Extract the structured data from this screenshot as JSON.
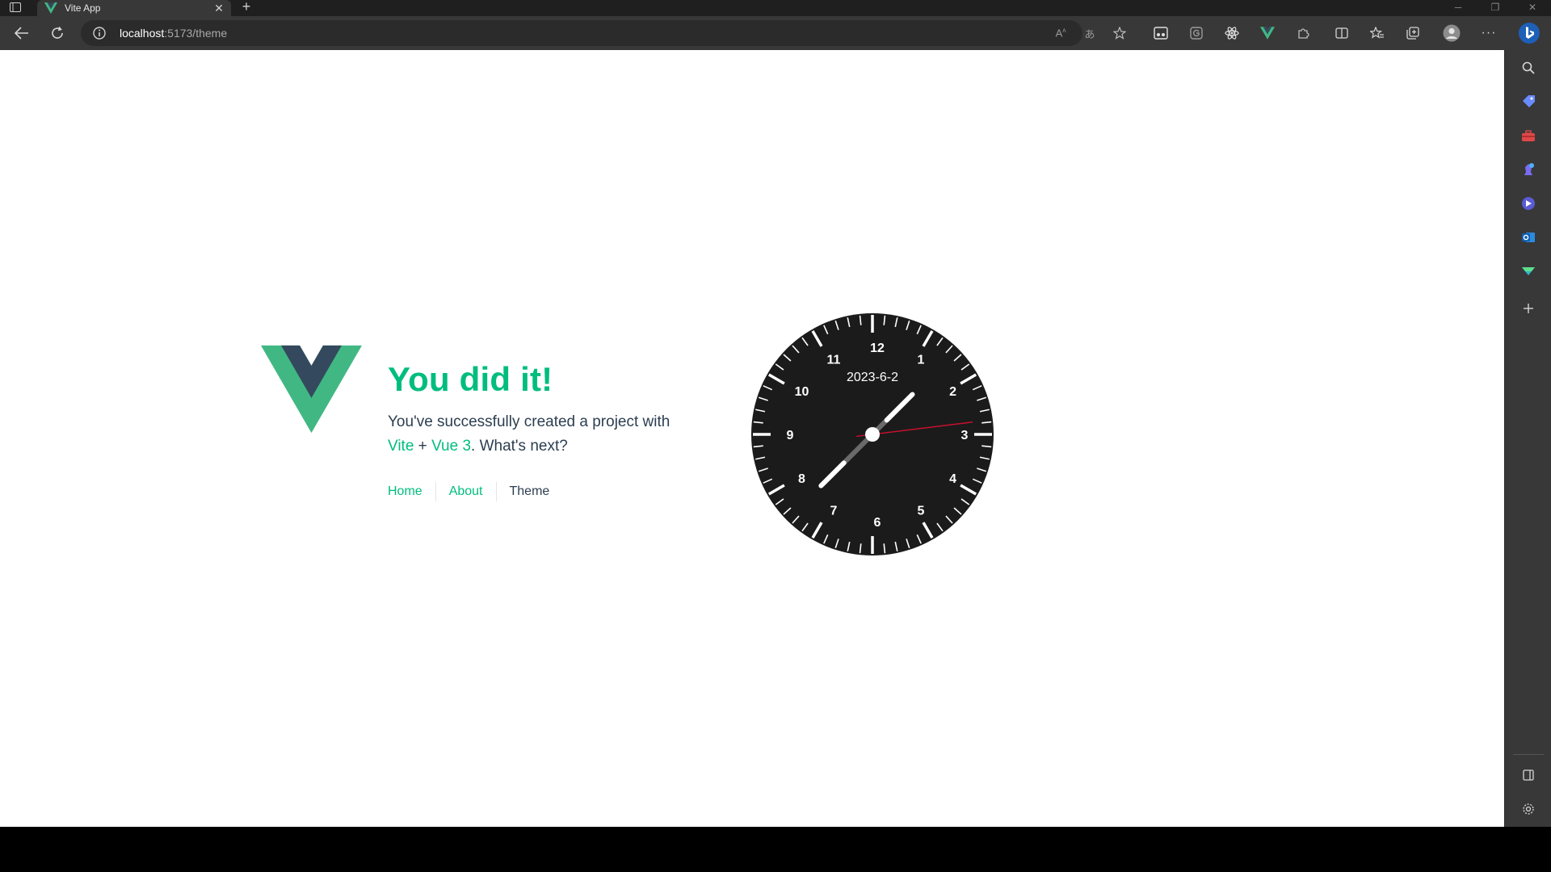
{
  "browser": {
    "tab": {
      "title": "Vite App"
    },
    "address": {
      "host": "localhost",
      "path": ":5173/theme"
    }
  },
  "page": {
    "heading": "You did it!",
    "description": {
      "line1": "You've successfully created a project with",
      "link_vite": "Vite",
      "plus": " + ",
      "link_vue": "Vue 3",
      "tail": ". What's next?"
    },
    "nav": [
      {
        "label": "Home"
      },
      {
        "label": "About"
      },
      {
        "label": "Theme"
      }
    ],
    "clock": {
      "date": "2023-6-2",
      "numbers": [
        "12",
        "1",
        "2",
        "3",
        "4",
        "5",
        "6",
        "7",
        "8",
        "9",
        "10",
        "11"
      ],
      "hour_hand_angle_deg": 225,
      "minute_hand_angle_deg": 45,
      "second_hand_angle_deg": 83
    }
  },
  "colors": {
    "vue_green": "#41b883",
    "vue_dark": "#35495e",
    "clock_face": "#1b1b1b",
    "second_hand": "#c8102e"
  },
  "sidebar_icons": [
    "search-icon",
    "tag-icon",
    "toolbox-icon",
    "chess-icon",
    "copilot-icon",
    "outlook-icon",
    "drop-icon",
    "add-icon",
    "panel-icon",
    "settings-icon"
  ]
}
